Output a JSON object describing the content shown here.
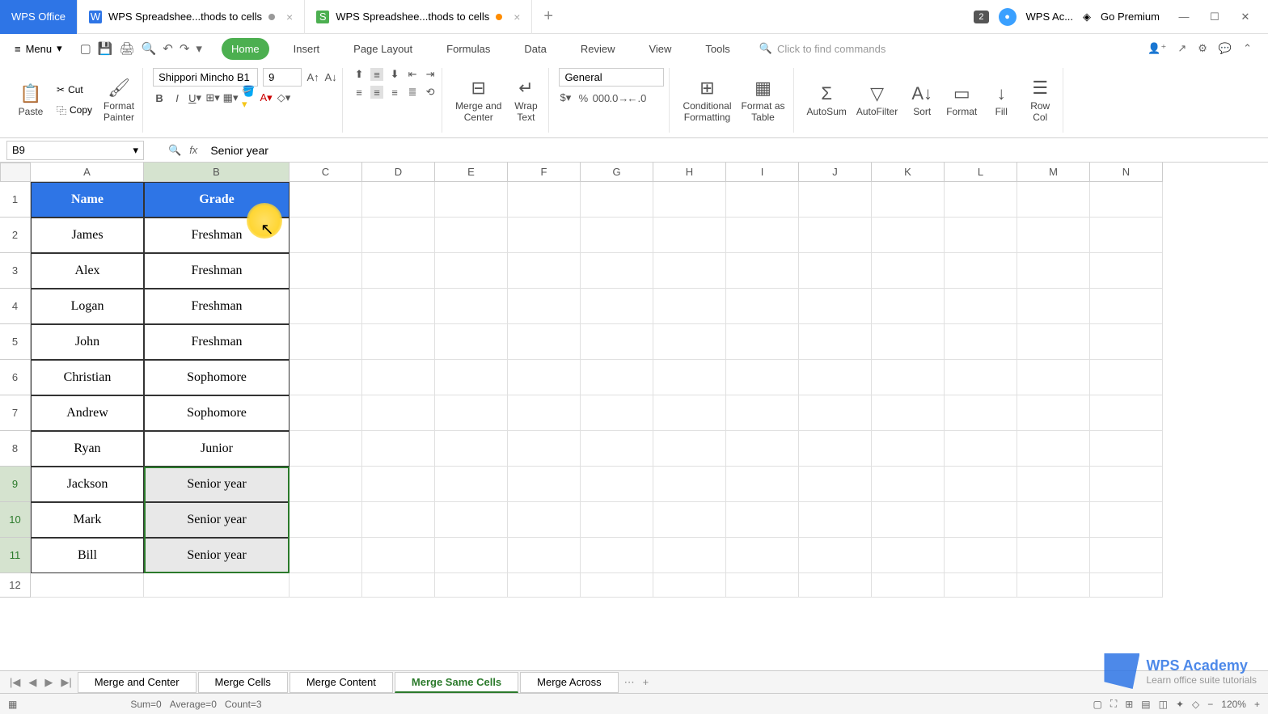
{
  "titlebar": {
    "app_name": "WPS Office",
    "tabs": [
      {
        "icon": "W",
        "label": "WPS Spreadshee...thods to cells",
        "modified": false
      },
      {
        "icon": "S",
        "label": "WPS Spreadshee...thods to cells",
        "modified": true
      }
    ],
    "notif_badge": "2",
    "user": "WPS Ac...",
    "premium": "Go Premium"
  },
  "menubar": {
    "menu": "Menu"
  },
  "ribbon_tabs": [
    "Home",
    "Insert",
    "Page Layout",
    "Formulas",
    "Data",
    "Review",
    "View",
    "Tools"
  ],
  "search_placeholder": "Click to find commands",
  "toolbar": {
    "paste": "Paste",
    "cut": "Cut",
    "copy": "Copy",
    "format_painter": "Format\nPainter",
    "font": "Shippori Mincho B1",
    "size": "9",
    "merge": "Merge and\nCenter",
    "wrap": "Wrap\nText",
    "numfmt": "General",
    "cond": "Conditional\nFormatting",
    "fastable": "Format as\nTable",
    "autosum": "AutoSum",
    "autofilter": "AutoFilter",
    "sort": "Sort",
    "format": "Format",
    "fill": "Fill",
    "rowcol": "Row\nCol"
  },
  "namebox": "B9",
  "formula": "Senior year",
  "columns": [
    "A",
    "B",
    "C",
    "D",
    "E",
    "F",
    "G",
    "H",
    "I",
    "J",
    "K",
    "L",
    "M",
    "N"
  ],
  "col_widths": {
    "A": 140,
    "B": 180,
    "default": 90
  },
  "row_heights": {
    "header": 24,
    "data": 44
  },
  "data_rows": [
    {
      "r": 1,
      "A": "Name",
      "B": "Grade",
      "hdr": true
    },
    {
      "r": 2,
      "A": "James",
      "B": "Freshman"
    },
    {
      "r": 3,
      "A": "Alex",
      "B": "Freshman"
    },
    {
      "r": 4,
      "A": "Logan",
      "B": "Freshman"
    },
    {
      "r": 5,
      "A": "John",
      "B": "Freshman"
    },
    {
      "r": 6,
      "A": "Christian",
      "B": "Sophomore"
    },
    {
      "r": 7,
      "A": "Andrew",
      "B": "Sophomore"
    },
    {
      "r": 8,
      "A": "Ryan",
      "B": "Junior"
    },
    {
      "r": 9,
      "A": "Jackson",
      "B": "Senior year",
      "sel": true
    },
    {
      "r": 10,
      "A": "Mark",
      "B": "Senior year",
      "sel": true
    },
    {
      "r": 11,
      "A": "Bill",
      "B": "Senior year",
      "sel": true
    }
  ],
  "extra_rows": [
    12
  ],
  "sheet_tabs": [
    "Merge and Center",
    "Merge Cells",
    "Merge Content",
    "Merge Same Cells",
    "Merge Across"
  ],
  "active_sheet": 3,
  "statusbar": {
    "sum": "Sum=0",
    "avg": "Average=0",
    "cnt": "Count=3",
    "zoom": "120%"
  },
  "watermark": {
    "brand": "WPS Academy",
    "sub": "Learn office suite tutorials"
  }
}
